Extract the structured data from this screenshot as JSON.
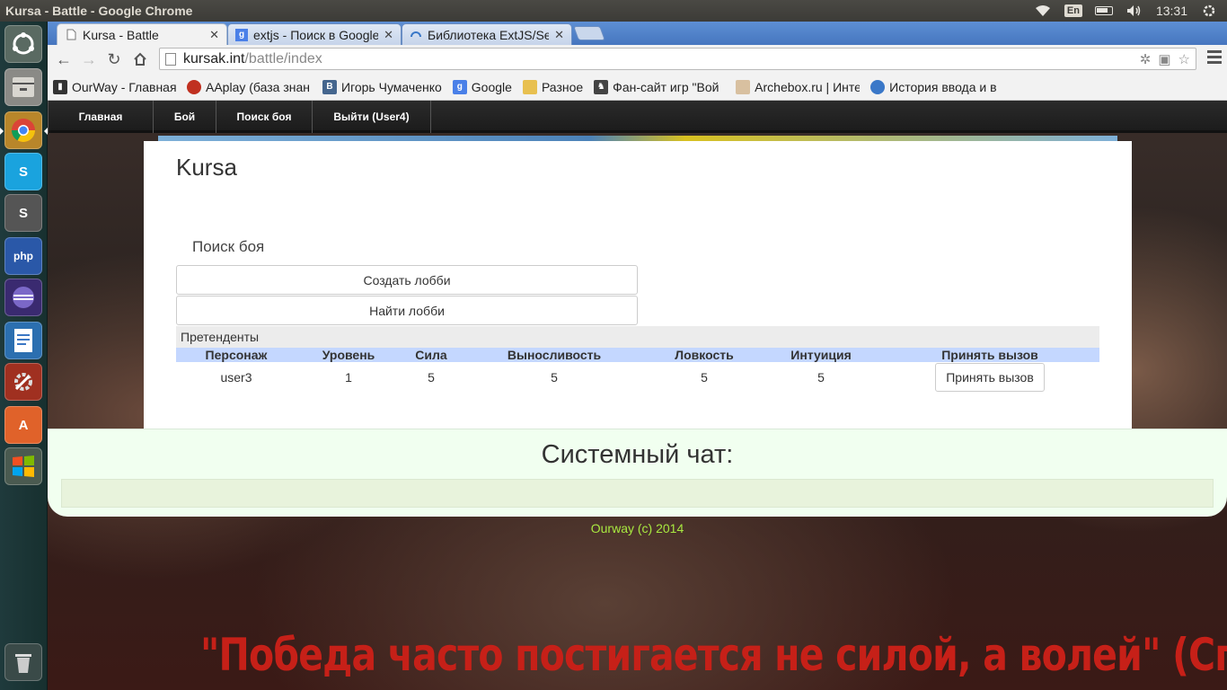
{
  "os": {
    "window_title": "Kursa - Battle - Google Chrome",
    "keyboard_layout": "En",
    "clock": "13:31",
    "launcher": [
      {
        "name": "dash",
        "label": ""
      },
      {
        "name": "files",
        "label": ""
      },
      {
        "name": "chrome",
        "label": ""
      },
      {
        "name": "skype",
        "label": "S"
      },
      {
        "name": "sublime",
        "label": "S"
      },
      {
        "name": "phpstorm",
        "label": "php"
      },
      {
        "name": "eclipse",
        "label": ""
      },
      {
        "name": "libreoffice-writer",
        "label": ""
      },
      {
        "name": "system-settings",
        "label": ""
      },
      {
        "name": "software-center",
        "label": "A"
      },
      {
        "name": "windows-app",
        "label": ""
      },
      {
        "name": "trash",
        "label": ""
      }
    ]
  },
  "browser": {
    "tabs": [
      {
        "label": "Kursa - Battle",
        "active": true
      },
      {
        "label": "extjs - Поиск в Google",
        "active": false
      },
      {
        "label": "Библиотека ExtJS/Se",
        "active": false
      }
    ],
    "url_host": "kursak.int",
    "url_path": "/battle/index",
    "bookmarks": [
      {
        "label": "OurWay - Главная с",
        "icon_color": "#333333"
      },
      {
        "label": "AAplay (база знан",
        "icon_color": "#c03020"
      },
      {
        "label": "Игорь Чумаченко",
        "icon_color": "#45668e"
      },
      {
        "label": "Google",
        "icon_color": "#4a80e8"
      },
      {
        "label": "Разное",
        "icon_color": "#d8b040"
      },
      {
        "label": "Фан-сайт игр \"Вой",
        "icon_color": "#444444"
      },
      {
        "label": "Archebox.ru | Инте",
        "icon_color": "#c8a878"
      },
      {
        "label": "История ввода и в",
        "icon_color": "#3a78c8"
      }
    ]
  },
  "page": {
    "nav": [
      "Главная",
      "Бой",
      "Поиск боя",
      "Выйти (User4)"
    ],
    "site_title": "Kursa",
    "section_title": "Поиск боя",
    "create_lobby": "Создать лобби",
    "find_lobby": "Найти лобби",
    "candidates_caption": "Претенденты",
    "columns": [
      "Персонаж",
      "Уровень",
      "Сила",
      "Выносливость",
      "Ловкость",
      "Интуиция",
      "Принять вызов"
    ],
    "rows": [
      {
        "character": "user3",
        "level": "1",
        "strength": "5",
        "endurance": "5",
        "agility": "5",
        "intuition": "5",
        "action": "Принять вызов"
      }
    ],
    "chat_title": "Системный чат:",
    "footer": "Ourway (c) 2014",
    "background_quote": "\"Победа часто постигается не силой, а волей\" (Спартак)"
  }
}
